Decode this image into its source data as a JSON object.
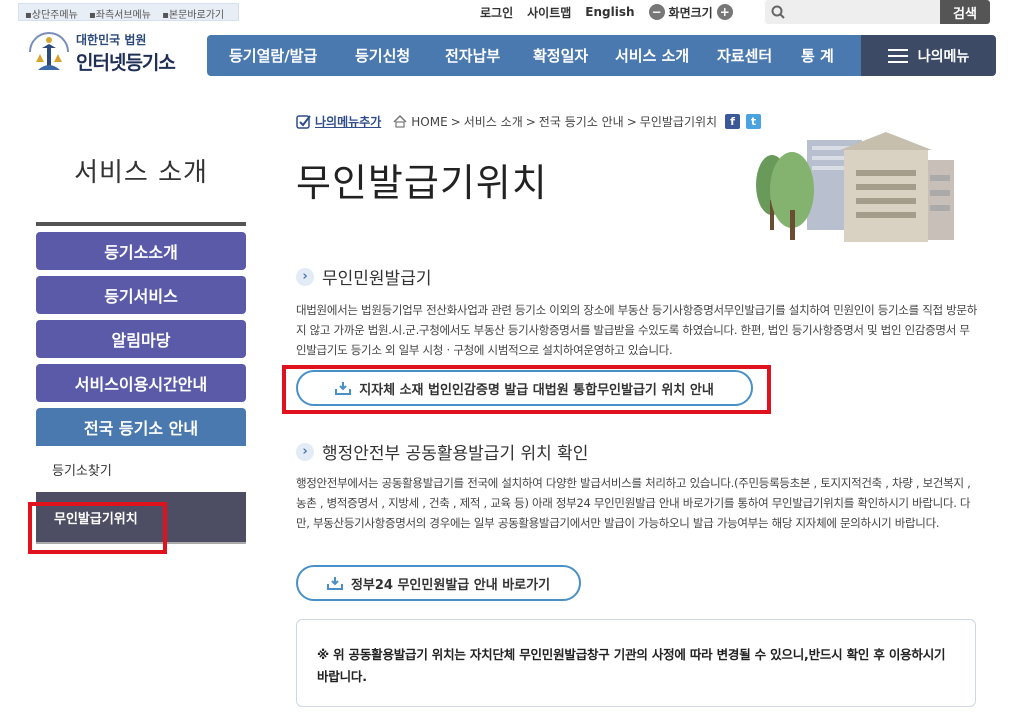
{
  "skipnav": [
    "상단주메뉴",
    "좌측서브메뉴",
    "본문바로가기"
  ],
  "util": {
    "login": "로그인",
    "sitemap": "사이트맵",
    "english": "English",
    "zoom_label": "화면크기",
    "zoom_out": "−",
    "zoom_in": "+"
  },
  "search": {
    "placeholder": "",
    "button": "검색"
  },
  "logo": {
    "small": "대한민국 법원",
    "big": "인터넷등기소"
  },
  "gnb": [
    "등기열람/발급",
    "등기신청",
    "전자납부",
    "확정일자",
    "서비스 소개",
    "자료센터",
    "통 계"
  ],
  "mymenu": "나의메뉴",
  "sidebar": {
    "title": "서비스 소개",
    "items": [
      "등기소소개",
      "등기서비스",
      "알림마당",
      "서비스이용시간안내",
      "전국 등기소 안내"
    ],
    "subitems": [
      "등기소찾기",
      "무인발급기위치"
    ]
  },
  "breadcrumb": {
    "add": "나의메뉴추가",
    "path": [
      "HOME",
      "서비스 소개",
      "전국 등기소 안내",
      "무인발급기위치"
    ]
  },
  "page_title": "무인발급기위치",
  "section1": {
    "title": "무인민원발급기",
    "desc": "대법원에서는 법원등기업무 전산화사업과 관련 등기소 이외의 장소에 부동산 등기사항증명서무인발급기를 설치하여 민원인이 등기소를 직접 방문하지 않고 가까운 법원.시.군.구청에서도 부동산 등기사항증명서를 발급받을 수있도록 하였습니다. 한편, 법인 등기사항증명서 및 법인 인감증명서 무인발급기도 등기소 외 일부 시청ㆍ구청에 시범적으로 설치하여운영하고 있습니다.",
    "button": "지자체 소재 법인인감증명 발급 대법원 통합무인발급기 위치 안내"
  },
  "section2": {
    "title": "행정안전부 공동활용발급기 위치 확인",
    "desc": "행정안전부에서는 공동활용발급기를 전국에 설치하여 다양한 발급서비스를 처리하고 있습니다.(주민등록등초본 , 토지지적건축 , 차량 , 보건복지 , 농촌 , 병적증명서 , 지방세 , 건축 , 제적 , 교육 등) 아래 정부24 무인민원발급 안내 바로가기를 통하여 무인발급기위치를 확인하시기 바랍니다. 다만, 부동산등기사항증명서의 경우에는 일부 공동활용발급기에서만 발급이 가능하오니 발급 가능여부는 해당 지자체에 문의하시기 바랍니다.",
    "button": "정부24 무인민원발급 안내 바로가기"
  },
  "notice": "※ 위 공동활용발급기 위치는 자치단체 무인민원발급창구 기관의 사정에 따라 변경될 수 있으니,반드시 확인 후 이용하시기 바랍니다.",
  "colors": {
    "gnb": "#4a79b0",
    "lnb": "#5a5aa8",
    "highlight": "#e0121e",
    "mymenu": "#3d4a66"
  }
}
